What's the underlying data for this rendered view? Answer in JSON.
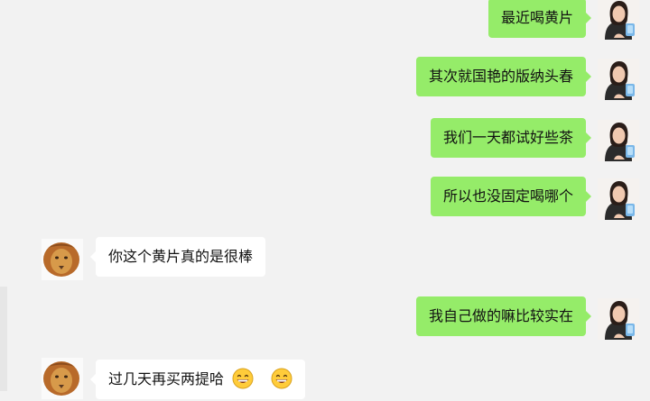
{
  "colors": {
    "background": "#f2f2f2",
    "outgoing_bubble": "#95ec69",
    "incoming_bubble": "#ffffff"
  },
  "messages": [
    {
      "direction": "out",
      "text": "最近喝黄片",
      "avatar": "woman-avatar"
    },
    {
      "direction": "out",
      "text": "其次就国艳的版纳头春",
      "avatar": "woman-avatar"
    },
    {
      "direction": "out",
      "text": "我们一天都试好些茶",
      "avatar": "woman-avatar"
    },
    {
      "direction": "out",
      "text": "所以也没固定喝哪个",
      "avatar": "woman-avatar"
    },
    {
      "direction": "in",
      "text": "你这个黄片真的是很棒",
      "avatar": "lion-avatar"
    },
    {
      "direction": "out",
      "text": "我自己做的嘛比较实在",
      "avatar": "woman-avatar"
    },
    {
      "direction": "in",
      "text": "过几天再买两提哈",
      "avatar": "lion-avatar",
      "emoji": [
        "grin-emoji",
        "grin-emoji"
      ]
    }
  ]
}
